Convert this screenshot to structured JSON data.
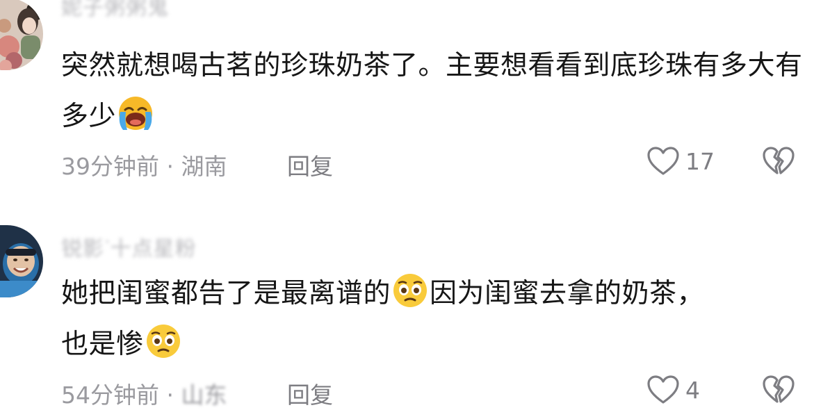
{
  "comments": [
    {
      "username": "妮子粥粥鬼",
      "text_segments": [
        "突然就想喝古茗的珍珠奶茶了。主要想看看到底珍珠有多大有多少"
      ],
      "emojis": [
        "loudly-crying-face-emoji"
      ],
      "time": "39分钟前",
      "separator": "·",
      "location": "湖南",
      "reply_label": "回复",
      "like_count": "17"
    },
    {
      "username": "锐影ᐝ十点星粉",
      "text_segments": [
        "她把闺蜜都告了是最离谱的",
        "因为闺蜜去拿的奶茶，",
        "也是惨"
      ],
      "emojis": [
        "pleading-face-emoji",
        "pleading-face-emoji"
      ],
      "time": "54分钟前",
      "separator": "·",
      "location": "山东",
      "reply_label": "回复",
      "like_count": "4"
    }
  ],
  "colors": {
    "text": "#161616",
    "meta": "#9a9a9f",
    "action": "#7d7d82",
    "username_blurred": "#b9b9bd"
  }
}
